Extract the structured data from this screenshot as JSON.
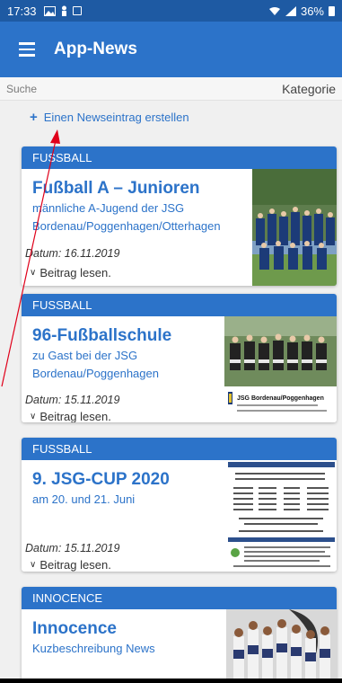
{
  "status": {
    "time": "17:33",
    "battery": "36%"
  },
  "appbar": {
    "title": "App-News"
  },
  "filter": {
    "search_placeholder": "Suche",
    "category_label": "Kategorie"
  },
  "add_link": {
    "label": "Einen Newseintrag erstellen"
  },
  "cards": [
    {
      "category": "FUSSBALL",
      "title": "Fußball A – Junioren",
      "subtitle": "männliche A-Jugend der JSG Bordenau/Poggenhagen/Otterhagen",
      "date": "Datum: 16.11.2019",
      "read_label": "Beitrag lesen."
    },
    {
      "category": "FUSSBALL",
      "title": "96-Fußballschule",
      "subtitle": "zu Gast bei der JSG Bordenau/Poggenhagen",
      "date": "Datum: 15.11.2019",
      "read_label": "Beitrag lesen.",
      "image_caption": "JSG Bordenau/Poggenhagen"
    },
    {
      "category": "FUSSBALL",
      "title": "9. JSG-CUP 2020",
      "subtitle": "am 20. und 21. Juni",
      "date": "Datum: 15.11.2019",
      "read_label": "Beitrag lesen."
    },
    {
      "category": "INNOCENCE",
      "title": "Innocence",
      "subtitle": "Kuzbeschreibung News"
    }
  ]
}
